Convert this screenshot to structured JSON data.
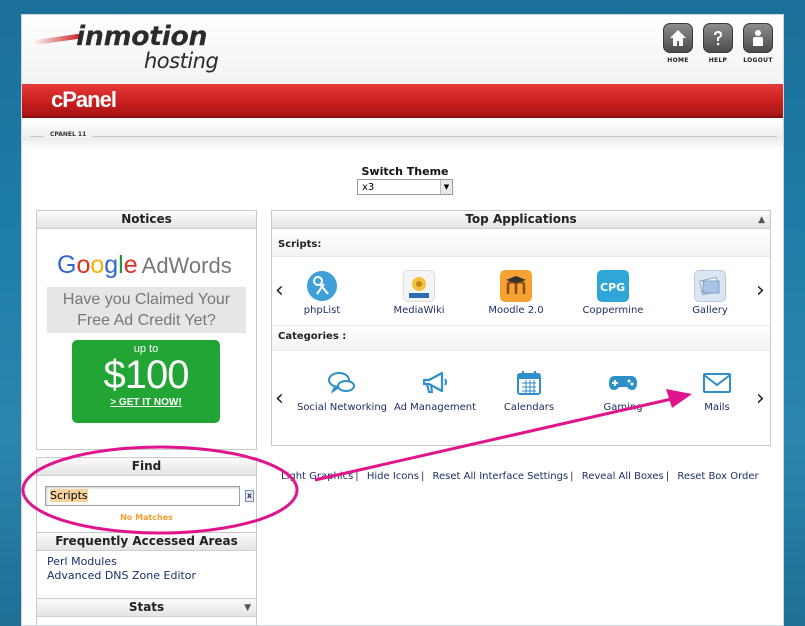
{
  "header": {
    "brand": "inmotion",
    "brand_sub": "hosting",
    "nav": [
      {
        "label": "HOME",
        "icon": "home-icon"
      },
      {
        "label": "HELP",
        "icon": "help-icon"
      },
      {
        "label": "LOGOUT",
        "icon": "logout-icon"
      }
    ],
    "title": "cPanel",
    "breadcrumb": "CPANEL 11"
  },
  "theme": {
    "label": "Switch Theme",
    "selected": "x3"
  },
  "notices": {
    "title": "Notices",
    "ad": {
      "brand_letters": [
        "G",
        "o",
        "o",
        "g",
        "l",
        "e"
      ],
      "product": "AdWords",
      "claim_line1": "Have you Claimed Your",
      "claim_line2": "Free Ad Credit Yet?",
      "upto": "up to",
      "amount": "$100",
      "cta": "> GET IT NOW!"
    }
  },
  "find": {
    "title": "Find",
    "value": "Scripts",
    "clear": "x",
    "status": "No Matches"
  },
  "frequent": {
    "title": "Frequently Accessed Areas",
    "items": [
      "Perl Modules",
      "Advanced DNS Zone Editor"
    ]
  },
  "stats": {
    "title": "Stats"
  },
  "top_apps": {
    "title": "Top Applications",
    "scripts_label": "Scripts:",
    "scripts": [
      {
        "label": "phpList",
        "icon": "phplist-icon",
        "color": "#3f9fd6"
      },
      {
        "label": "MediaWiki",
        "icon": "mediawiki-icon",
        "color": "#f2c23b"
      },
      {
        "label": "Moodle 2.0",
        "icon": "moodle-icon",
        "color": "#f5a233"
      },
      {
        "label": "Coppermine",
        "icon": "coppermine-icon",
        "color": "#2ea6d8"
      },
      {
        "label": "Gallery",
        "icon": "gallery-icon",
        "color": "#a8c4e4"
      }
    ],
    "categories_label": "Categories :",
    "categories": [
      {
        "label": "Social Networking",
        "icon": "chat-bubbles-icon"
      },
      {
        "label": "Ad Management",
        "icon": "megaphone-icon"
      },
      {
        "label": "Calendars",
        "icon": "calendar-icon"
      },
      {
        "label": "Gaming",
        "icon": "gamepad-icon"
      },
      {
        "label": "Mails",
        "icon": "envelope-icon"
      }
    ],
    "prev": "‹",
    "next": "›"
  },
  "links": [
    "Light Graphics",
    "Hide Icons",
    "Reset All Interface Settings",
    "Reveal All Boxes",
    "Reset Box Order"
  ],
  "annotation_color": "#e0148c"
}
